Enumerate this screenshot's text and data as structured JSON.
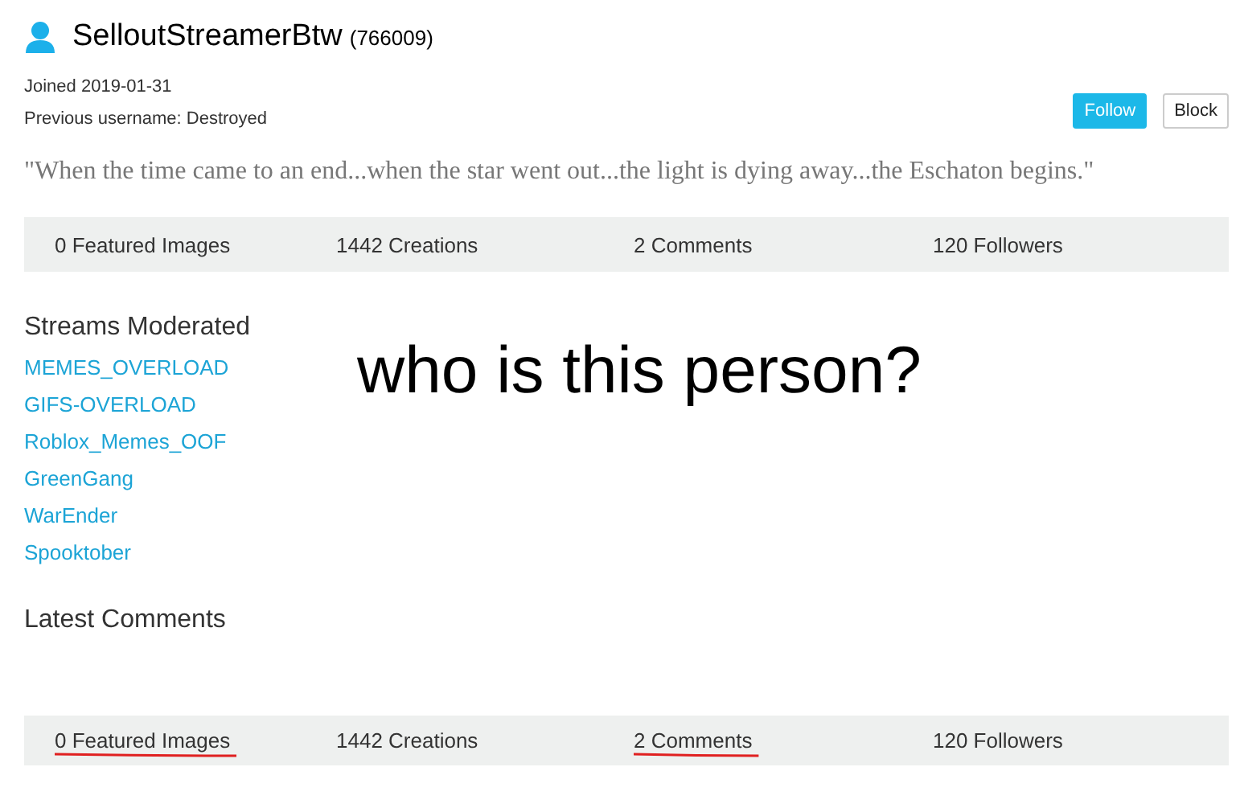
{
  "profile": {
    "username": "SelloutStreamerBtw",
    "points": "(766009)",
    "joined": "Joined 2019-01-31",
    "previous_username": "Previous username: Destroyed"
  },
  "buttons": [
    {
      "label": "Follow",
      "kind": "primary"
    },
    {
      "label": "Block",
      "kind": "plain"
    }
  ],
  "quote": "\"When the time came to an end...when the star went out...the light is dying away...the Eschaton begins.\"",
  "stats_top": [
    {
      "label": "0 Featured Images"
    },
    {
      "label": "1442 Creations"
    },
    {
      "label": "2 Comments"
    },
    {
      "label": "120 Followers"
    }
  ],
  "streams_moderated": {
    "heading": "Streams Moderated",
    "items": [
      "MEMES_OVERLOAD",
      "GIFS-OVERLOAD",
      "Roblox_Memes_OOF",
      "GreenGang",
      "WarEnder",
      "Spooktober"
    ]
  },
  "latest_comments": {
    "heading": "Latest Comments"
  },
  "stats_bottom": [
    {
      "label": "0 Featured Images",
      "underlined": true
    },
    {
      "label": "1442 Creations",
      "underlined": false
    },
    {
      "label": "2 Comments",
      "underlined": true
    },
    {
      "label": "120 Followers",
      "underlined": false
    }
  ],
  "caption": "who is this person?"
}
